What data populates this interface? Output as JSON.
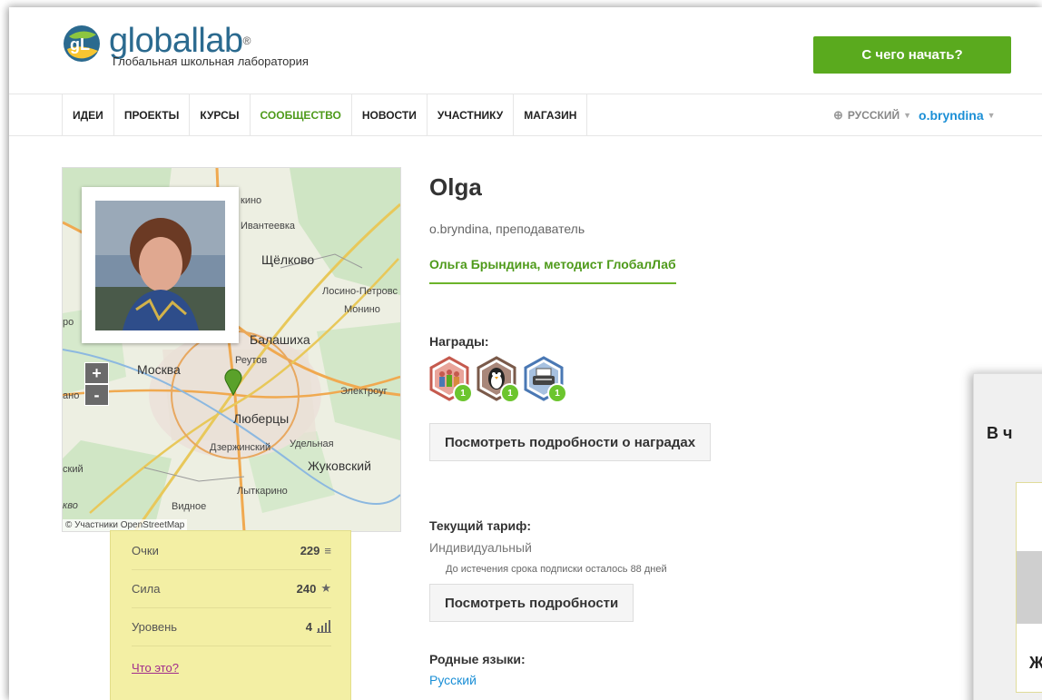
{
  "header": {
    "logo_name": "globallab",
    "logo_reg": "®",
    "logo_subtitle": "Глобальная школьная лаборатория",
    "start_button": "С чего начать?"
  },
  "nav": {
    "items": [
      {
        "label": "ИДЕИ"
      },
      {
        "label": "ПРОЕКТЫ"
      },
      {
        "label": "КУРСЫ"
      },
      {
        "label": "СООБЩЕСТВО",
        "active": true
      },
      {
        "label": "НОВОСТИ"
      },
      {
        "label": "УЧАСТНИКУ"
      },
      {
        "label": "МАГАЗИН"
      }
    ],
    "language": "РУССКИЙ",
    "user": "o.bryndina"
  },
  "map": {
    "labels": [
      "кино",
      "Ивантеевка",
      "Щёлково",
      "Лосино-Петровс",
      "Монино",
      "Балашиха",
      "Москва",
      "Реутов",
      "Электроуг",
      "Люберцы",
      "Дзержинский",
      "Удельная",
      "Жуковский",
      "Лыткарино",
      "ский",
      "Видное",
      "кво",
      "ано",
      "ро"
    ],
    "zoom_in": "+",
    "zoom_out": "-",
    "attribution": "© Участники OpenStreetMap"
  },
  "stats": {
    "rows": [
      {
        "label": "Очки",
        "value": "229",
        "icon": "≡"
      },
      {
        "label": "Сила",
        "value": "240",
        "icon": "★"
      },
      {
        "label": "Уровень",
        "value": "4",
        "icon": "bars"
      }
    ],
    "what_link": "Что это?"
  },
  "profile": {
    "name": "Olga",
    "role": "o.bryndina, преподаватель",
    "title": "Ольга Брындина, методист ГлобалЛаб",
    "awards_label": "Награды:",
    "badges": [
      {
        "icon": "people-badge-icon",
        "count": "1",
        "color": "#c55a4e"
      },
      {
        "icon": "penguin-badge-icon",
        "count": "1",
        "color": "#8a6b5a"
      },
      {
        "icon": "typewriter-badge-icon",
        "count": "1",
        "color": "#4a78b4"
      }
    ],
    "awards_button": "Посмотреть подробности о наградах",
    "tariff_label": "Текущий тариф:",
    "tariff_value": "Индивидуальный",
    "tariff_note": "До истечения срока подписки осталось 88 дней",
    "details_button": "Посмотреть подробности",
    "languages_label": "Родные языки:",
    "languages_value": "Русский"
  },
  "overlay": {
    "title": "В ч",
    "bottom_letter": "Ж"
  },
  "colors": {
    "brand_green": "#5aaa1e",
    "link_blue": "#1b8fd6",
    "stats_bg": "#f3efa4"
  }
}
